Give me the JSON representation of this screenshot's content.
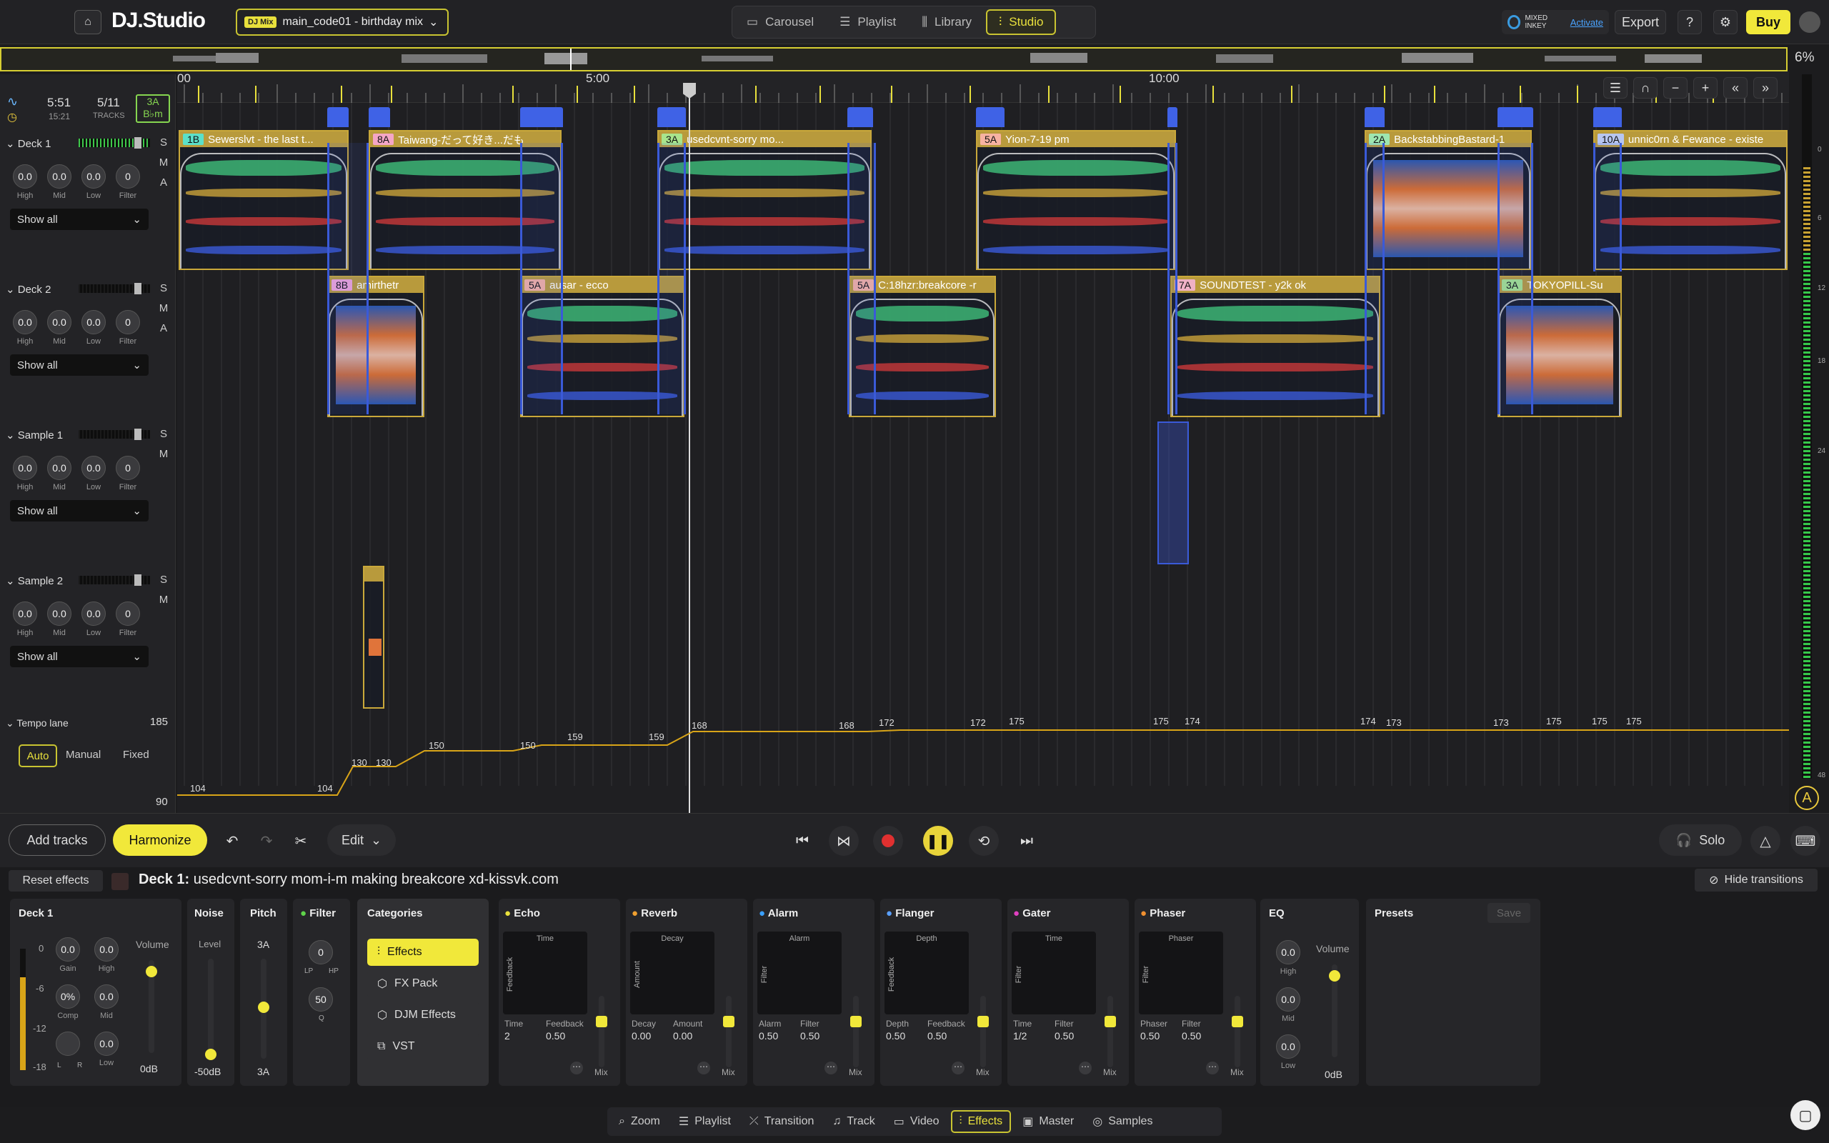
{
  "app": {
    "logo": "DJ.Studio",
    "mix_badge": "DJ Mix",
    "mix_name": "main_code01 - birthday mix"
  },
  "modes": [
    {
      "label": "Carousel"
    },
    {
      "label": "Playlist"
    },
    {
      "label": "Library"
    },
    {
      "label": "Studio"
    }
  ],
  "mixedinkey": {
    "brand": "MIXED INKEY",
    "activate": "Activate"
  },
  "top": {
    "export": "Export",
    "help": "?",
    "buy": "Buy"
  },
  "overview": {
    "zoom": "6%"
  },
  "ruler": {
    "marks": [
      "00",
      "5:00",
      "10:00"
    ]
  },
  "stats": {
    "duration": "5:51",
    "total": "15:21",
    "tracks": "5/11",
    "tracks_label": "TRACKS",
    "key": "3A",
    "key_sub": "B♭m"
  },
  "decks": [
    {
      "name": "Deck 1",
      "knobs": [
        "0.0",
        "0.0",
        "0.0",
        "0"
      ],
      "labels": [
        "High",
        "Mid",
        "Low",
        "Filter"
      ],
      "show": "Show all",
      "sma": [
        "S",
        "M",
        "A"
      ]
    },
    {
      "name": "Deck 2",
      "knobs": [
        "0.0",
        "0.0",
        "0.0",
        "0"
      ],
      "labels": [
        "High",
        "Mid",
        "Low",
        "Filter"
      ],
      "show": "Show all",
      "sma": [
        "S",
        "M",
        "A"
      ]
    },
    {
      "name": "Sample 1",
      "knobs": [
        "0.0",
        "0.0",
        "0.0",
        "0"
      ],
      "labels": [
        "High",
        "Mid",
        "Low",
        "Filter"
      ],
      "show": "Show all",
      "sma": [
        "S",
        "M"
      ]
    },
    {
      "name": "Sample 2",
      "knobs": [
        "0.0",
        "0.0",
        "0.0",
        "0"
      ],
      "labels": [
        "High",
        "Mid",
        "Low",
        "Filter"
      ],
      "show": "Show all",
      "sma": [
        "S",
        "M"
      ]
    }
  ],
  "tempo_lane": {
    "label": "Tempo lane",
    "top": "185",
    "bottom": "90",
    "modes": [
      "Auto",
      "Manual",
      "Fixed"
    ],
    "values": [
      "104",
      "104",
      "130",
      "130",
      "150",
      "150",
      "159",
      "159",
      "168",
      "168",
      "172",
      "172",
      "175",
      "175",
      "174",
      "174",
      "173",
      "173",
      "175",
      "175",
      "175"
    ]
  },
  "clips": [
    {
      "key": "1B",
      "title": "Sewerslvt - the last t..."
    },
    {
      "key": "8A",
      "title": "Taiwang-だって好き...だも"
    },
    {
      "key": "3A",
      "title": "usedcvnt-sorry mo..."
    },
    {
      "key": "5A",
      "title": "Yion-7-19 pm"
    },
    {
      "key": "2A",
      "title": "BackstabbingBastard-1"
    },
    {
      "key": "10A",
      "title": "unnic0rn & Fewance - existe"
    },
    {
      "key": "8B",
      "title": "amirthetr"
    },
    {
      "key": "5A",
      "title": "ausar - ecco"
    },
    {
      "key": "5A",
      "title": "C:18hzr:breakcore -r"
    },
    {
      "key": "7A",
      "title": "SOUNDTEST - y2k ok"
    },
    {
      "key": "3A",
      "title": "TOKYOPILL-Su"
    }
  ],
  "bottom": {
    "add_tracks": "Add tracks",
    "harmonize": "Harmonize",
    "edit": "Edit",
    "solo": "Solo"
  },
  "fx": {
    "reset": "Reset effects",
    "deck_prefix": "Deck 1:",
    "deck_track": "usedcvnt-sorry mom-i-m making breakcore xd-kissvk.com",
    "hide_transitions": "Hide transitions",
    "deck1": {
      "title": "Deck 1",
      "gain": "0.0",
      "high": "0.0",
      "comp": "0%",
      "mid": "0.0",
      "low": "0.0",
      "volume": "Volume",
      "vol_val": "0dB",
      "scale": [
        "0",
        "-6",
        "-12",
        "-18"
      ],
      "lbl": [
        "Gain",
        "High",
        "Comp",
        "Mid",
        "L",
        "R",
        "Low"
      ]
    },
    "noise": {
      "title": "Noise",
      "level": "Level",
      "val": "-50dB"
    },
    "pitch": {
      "title": "Pitch",
      "top": "3A",
      "bottom": "3A"
    },
    "filter": {
      "title": "Filter",
      "v1": "0",
      "lp": "LP",
      "hp": "HP",
      "v2": "50",
      "q": "Q"
    },
    "categories": {
      "title": "Categories",
      "items": [
        "Effects",
        "FX Pack",
        "DJM Effects",
        "VST"
      ]
    },
    "units": [
      {
        "title": "Echo",
        "axis_top": "Time",
        "axis_left": "Feedback",
        "p1": "Time",
        "p2": "Feedback",
        "v1": "2",
        "v2": "0.50",
        "mix": "Mix"
      },
      {
        "title": "Reverb",
        "axis_top": "Decay",
        "axis_left": "Amount",
        "p1": "Decay",
        "p2": "Amount",
        "v1": "0.00",
        "v2": "0.00",
        "mix": "Mix"
      },
      {
        "title": "Alarm",
        "axis_top": "Alarm",
        "axis_left": "Filter",
        "p1": "Alarm",
        "p2": "Filter",
        "v1": "0.50",
        "v2": "0.50",
        "mix": "Mix"
      },
      {
        "title": "Flanger",
        "axis_top": "Depth",
        "axis_left": "Feedback",
        "p1": "Depth",
        "p2": "Feedback",
        "v1": "0.50",
        "v2": "0.50",
        "mix": "Mix"
      },
      {
        "title": "Gater",
        "axis_top": "Time",
        "axis_left": "Filter",
        "p1": "Time",
        "p2": "Filter",
        "v1": "1/2",
        "v2": "0.50",
        "mix": "Mix"
      },
      {
        "title": "Phaser",
        "axis_top": "Phaser",
        "axis_left": "Filter",
        "p1": "Phaser",
        "p2": "Filter",
        "v1": "0.50",
        "v2": "0.50",
        "mix": "Mix"
      }
    ],
    "eq": {
      "title": "EQ",
      "high": "0.0",
      "mid": "0.0",
      "low": "0.0",
      "lh": "High",
      "lm": "Mid",
      "ll": "Low",
      "volume": "Volume",
      "vol_val": "0dB"
    },
    "presets": {
      "title": "Presets",
      "save": "Save"
    }
  },
  "tabs": [
    {
      "label": "Zoom"
    },
    {
      "label": "Playlist"
    },
    {
      "label": "Transition"
    },
    {
      "label": "Track"
    },
    {
      "label": "Video"
    },
    {
      "label": "Effects"
    },
    {
      "label": "Master"
    },
    {
      "label": "Samples"
    }
  ],
  "meter_scale": [
    "0",
    "6",
    "12",
    "18",
    "24",
    "48"
  ]
}
